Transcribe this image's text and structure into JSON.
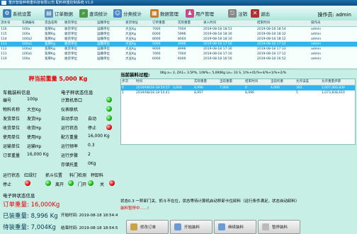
{
  "titlebar": {
    "text": "重庆智能秤称重科技有限公司 配料称重控制系统 V1.0"
  },
  "toolbar": {
    "buttons": [
      {
        "label": "系统设置",
        "icon": "gear-icon",
        "color": "#3f7fb5"
      },
      {
        "label": "订单数据",
        "icon": "document-icon",
        "color": "#5a8fbf"
      },
      {
        "label": "查询统计",
        "icon": "search-icon",
        "color": "#4a9a4a"
      },
      {
        "label": "分类统计",
        "icon": "user-icon",
        "color": "#4a86c5"
      },
      {
        "label": "数据管理",
        "icon": "database-icon",
        "color": "#c77b2e"
      },
      {
        "label": "用户管理",
        "icon": "users-icon",
        "color": "#c74a8a"
      },
      {
        "label": "注销",
        "icon": "logout-icon",
        "color": "#888888"
      },
      {
        "label": "退出",
        "icon": "exit-icon",
        "color": "#b03030"
      }
    ],
    "operator_label": "操作员:",
    "operator": "admin"
  },
  "orders": {
    "headers": [
      "流水号",
      "车辆编号",
      "货品名称",
      "收货单位",
      "运输单位",
      "发货地址",
      "订单重量",
      "实际重量",
      "录入时间",
      "结束时间",
      "操作员"
    ],
    "rows": [
      [
        "116",
        "100a",
        "宽厚Kg",
        "收货单位",
        "运输单位",
        "大豆Kg",
        "7000",
        "7004",
        "2019-08-18 18:53",
        "2019-08-18 18:54",
        "admin"
      ],
      [
        "115",
        "100a",
        "宽厚Kg",
        "收货单位",
        "运输单位",
        "大豆Kg",
        "6000",
        "5996",
        "2019-08-18 18:30",
        "2019-08-18 18:32",
        "admin"
      ],
      [
        "114",
        "100a2",
        "宽厚Kg",
        "收货单位",
        "运输单位",
        "大豆Kg",
        "8000",
        "8004",
        "2019-08-18 18:10",
        "2019-08-18 18:12",
        "admin"
      ],
      [
        "113",
        "100a1",
        "宽厚Kg",
        "收货单位",
        "运输单位",
        "大豆Kg",
        "5000",
        "4996",
        "2019-08-18 17:50",
        "2019-08-18 17:52",
        "admin"
      ],
      [
        "112",
        "100a2",
        "宽厚Kg",
        "收货单位",
        "运输单位",
        "大豆Kg",
        "9000",
        "8996",
        "2019-08-18 17:30",
        "2019-08-18 17:33",
        "admin"
      ],
      [
        "111",
        "100a1",
        "宽厚Kg",
        "收货单位",
        "运输单位",
        "大豆Kg",
        "7000",
        "7004",
        "2019-08-18 17:10",
        "2019-08-18 17:12",
        "admin"
      ],
      [
        "110",
        "100a",
        "宽厚Kg",
        "收货单位",
        "运输单位",
        "大豆Kg",
        "6000",
        "6000",
        "2019-08-18 16:50",
        "2019-08-18 16:52",
        "admin"
      ]
    ],
    "selected_index": 3
  },
  "scale": {
    "current_weight": "秤当前重量  5,000 Kg"
  },
  "vehicle": {
    "title": "车载装料信息",
    "fields": [
      {
        "label": "编号",
        "value": "100p"
      },
      {
        "label": "物料名称",
        "value": "大豆Kg"
      },
      {
        "label": "发货单位",
        "value": "发货Hp"
      },
      {
        "label": "收货单位",
        "value": "收货Hp"
      },
      {
        "label": "使用单位",
        "value": "使用Hp"
      },
      {
        "label": "运输单位",
        "value": "运输Hp"
      },
      {
        "label": "订单重量",
        "value": "16,000 Kg"
      }
    ]
  },
  "control": {
    "title": "电子秤状态信息",
    "fields": [
      {
        "label": "计算机串口",
        "value": ""
      },
      {
        "label": "仪表联机",
        "value": ""
      },
      {
        "label": "自动手动",
        "value": "自动"
      },
      {
        "label": "运行状态",
        "value": "停止"
      },
      {
        "label": "配方重量",
        "value": "16,000 Kg"
      },
      {
        "label": "运行频率",
        "value": "0.3"
      },
      {
        "label": "运行步骤",
        "value": "2"
      },
      {
        "label": "存储托重",
        "value": "0Kg"
      }
    ]
  },
  "indicators": {
    "labels": [
      "运行状态",
      "红绿灯",
      "抓斗位置",
      "料门检测",
      "秤卸料"
    ],
    "values": [
      "停止",
      "",
      "离开",
      "门开",
      "关"
    ]
  },
  "summary": {
    "title": "电子秤状态信息",
    "order_weight_label": "订单重量:",
    "order_weight": "16,000Kg",
    "loaded_label": "已装重量:",
    "loaded": "8,996 Kg",
    "pending_label": "待装重量:",
    "pending": "7,004Kg",
    "start_label": "开始时间:",
    "start": "2019-08-18 18:54:41",
    "end_label": "结束时间:",
    "end": "2019-08-18 18:54:54"
  },
  "process": {
    "title": "当前装料过程:",
    "info": "0Kg  a= 2,  ZA1= 3.5P%, 1/W%= 5,000Kg  La= 33 S,  1/%+41/%+4/%+1/%+2/%",
    "headers": [
      "步次",
      "时间",
      "",
      "实际重量",
      "当前重量",
      "结束时间",
      "当前托重",
      "允许误差",
      "允许重量步骤"
    ],
    "rows": [
      [
        "0",
        "2019/08/18 18:54:57",
        "3,004",
        "8,996",
        "7,004",
        "0",
        "4,000",
        "302",
        "2,007,000,830"
      ],
      [
        "1",
        "2019/08/18 18:54:41",
        "",
        "8,997",
        "",
        "8,996",
        "",
        "5",
        "1,073,838,610"
      ]
    ]
  },
  "message": {
    "line1": "状态0.3 一秤卸门关、抓斗不在位，状态等待计算机启动秤卸卡住卸料（运行条件满足，状态自动卸料）",
    "line2": "装料暂停中......!"
  },
  "buttons": [
    {
      "label": "修改订单",
      "icon": "edit-icon"
    },
    {
      "label": "开始装料",
      "icon": "play-icon"
    },
    {
      "label": "继续装料",
      "icon": "resume-icon"
    },
    {
      "label": "暂停装料",
      "icon": "pause-icon"
    }
  ]
}
